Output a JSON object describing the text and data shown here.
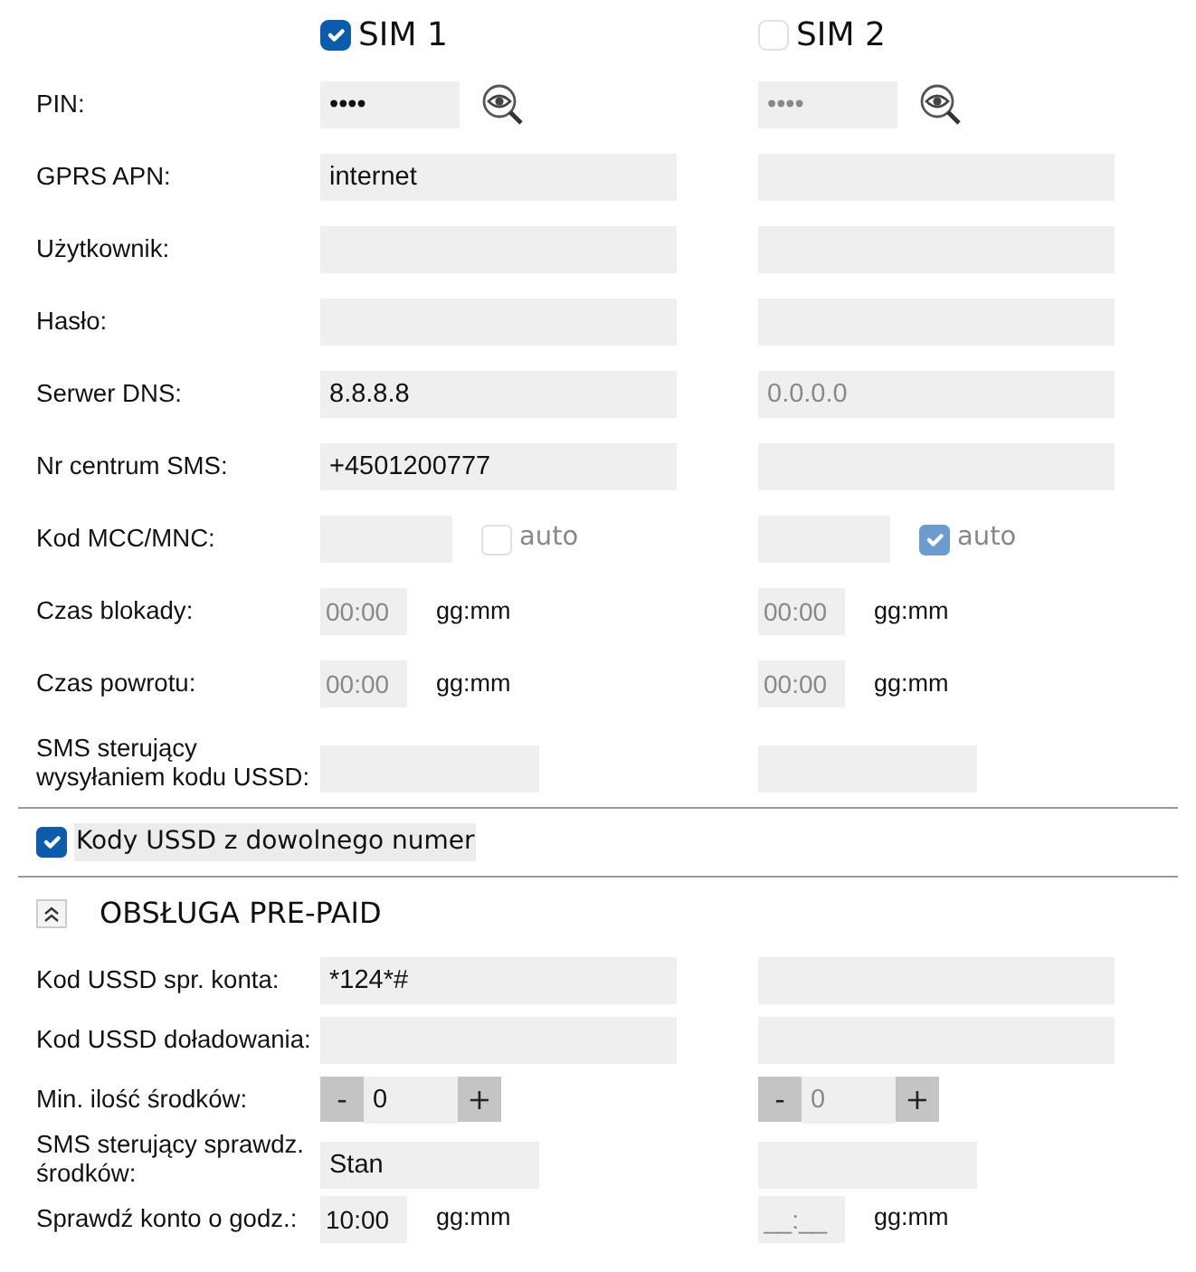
{
  "sims": [
    {
      "label": "SIM 1",
      "checked": true
    },
    {
      "label": "SIM 2",
      "checked": false
    }
  ],
  "rows": [
    {
      "label": "PIN:",
      "kind": "pin",
      "cells": [
        {
          "value": "••••"
        },
        {
          "value": "••••"
        }
      ]
    },
    {
      "label": "GPRS APN:",
      "kind": "text",
      "cells": [
        {
          "value": "internet"
        },
        {}
      ]
    },
    {
      "label": "Użytkownik:",
      "kind": "text",
      "cells": [
        {},
        {}
      ]
    },
    {
      "label": "Hasło:",
      "kind": "text",
      "cells": [
        {},
        {}
      ]
    },
    {
      "label": "Serwer DNS:",
      "kind": "text",
      "cells": [
        {
          "value": "8.8.8.8"
        },
        {
          "value": "0.0.0.0"
        }
      ]
    },
    {
      "label": "Nr centrum SMS:",
      "kind": "text",
      "cells": [
        {
          "value": "+4501200777"
        },
        {}
      ]
    },
    {
      "label": "Kod MCC/MNC:",
      "kind": "mcc",
      "cells": [
        {
          "auto_label": "auto",
          "auto": false
        },
        {
          "auto_label": "auto",
          "auto": true
        }
      ]
    },
    {
      "label": "Czas blokady:",
      "kind": "time",
      "cells": [
        {
          "placeholder": "00:00",
          "unit": "gg:mm"
        },
        {
          "placeholder": "00:00",
          "unit": "gg:mm"
        }
      ]
    },
    {
      "label": "Czas powrotu:",
      "kind": "time",
      "cells": [
        {
          "placeholder": "00:00",
          "unit": "gg:mm"
        },
        {
          "placeholder": "00:00",
          "unit": "gg:mm"
        }
      ]
    },
    {
      "label": "SMS sterujący wysyłaniem kodu USSD:",
      "kind": "short",
      "cells": [
        {},
        {}
      ]
    }
  ],
  "ussd_any_number": {
    "label": "Kody USSD z dowolnego numer",
    "checked": true
  },
  "prepaid": {
    "title": "OBSŁUGA PRE-PAID",
    "expanded": true,
    "rows": [
      {
        "label": "Kod USSD spr. konta:",
        "kind": "text",
        "cells": [
          {
            "value": "*124*#"
          },
          {}
        ]
      },
      {
        "label": "Kod USSD doładowania:",
        "kind": "text",
        "cells": [
          {},
          {}
        ]
      },
      {
        "label": "Min. ilość środków:",
        "kind": "stepper",
        "cells": [
          {
            "value": "0",
            "minus": "-",
            "plus": "+"
          },
          {
            "value": "0",
            "minus": "-",
            "plus": "+"
          }
        ]
      },
      {
        "label": "SMS sterujący sprawdz. środków:",
        "kind": "short",
        "cells": [
          {
            "value": "Stan"
          },
          {}
        ]
      },
      {
        "label": "Sprawdź konto o godz.:",
        "kind": "time",
        "cells": [
          {
            "value": "10:00",
            "unit": "gg:mm"
          },
          {
            "value": "__:__",
            "unit": "gg:mm"
          }
        ]
      }
    ]
  }
}
